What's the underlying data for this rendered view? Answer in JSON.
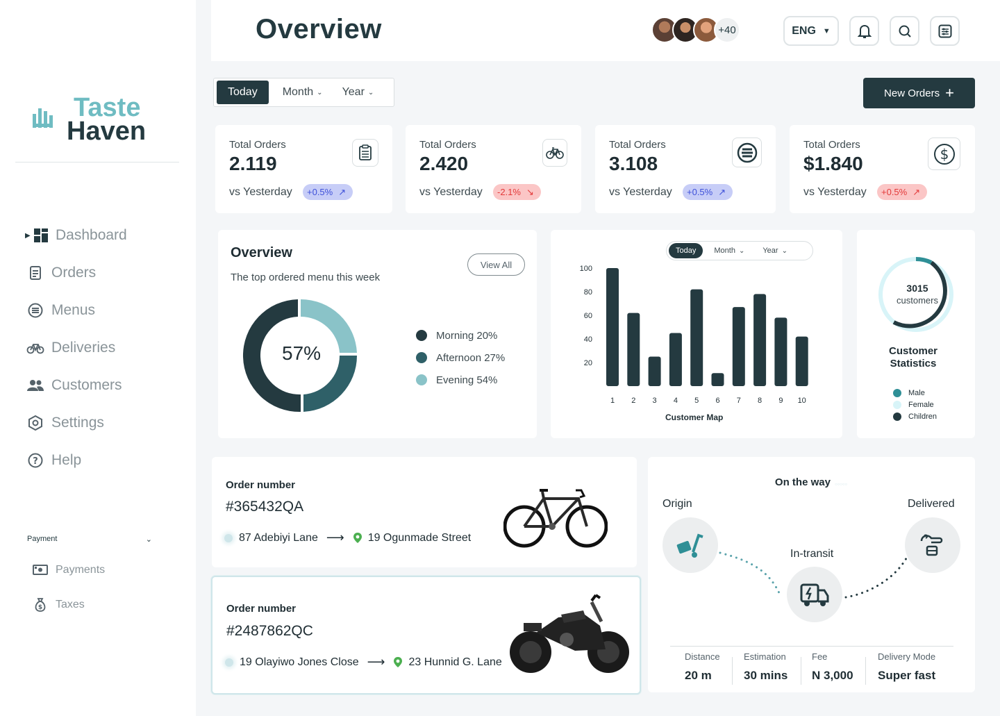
{
  "brand": {
    "line1": "Taste",
    "line2": "Haven"
  },
  "nav": [
    {
      "label": "Dashboard",
      "icon": "dashboard-icon"
    },
    {
      "label": "Orders",
      "icon": "orders-icon"
    },
    {
      "label": "Menus",
      "icon": "menus-icon"
    },
    {
      "label": "Deliveries",
      "icon": "bicycle-icon"
    },
    {
      "label": "Customers",
      "icon": "customers-icon"
    },
    {
      "label": "Settings",
      "icon": "settings-icon"
    },
    {
      "label": "Help",
      "icon": "help-icon"
    }
  ],
  "payment_section": {
    "heading": "Payment",
    "items": [
      {
        "label": "Payments",
        "icon": "cash-icon"
      },
      {
        "label": "Taxes",
        "icon": "money-bag-icon"
      }
    ]
  },
  "header": {
    "title": "Overview",
    "avatar_more": "+40",
    "language": "ENG"
  },
  "period": {
    "today": "Today",
    "month": "Month",
    "year": "Year"
  },
  "new_orders_label": "New Orders",
  "stats": [
    {
      "label": "Total Orders",
      "value": "2.119",
      "compare": "vs Yesterday",
      "change": "+0.5%",
      "trend": "up",
      "icon": "clipboard-icon"
    },
    {
      "label": "Total Orders",
      "value": "2.420",
      "compare": "vs Yesterday",
      "change": "-2.1%",
      "trend": "down",
      "icon": "bicycle-icon"
    },
    {
      "label": "Total Orders",
      "value": "3.108",
      "compare": "vs Yesterday",
      "change": "+0.5%",
      "trend": "up",
      "icon": "menu-lines-icon"
    },
    {
      "label": "Total Orders",
      "value": "$1.840",
      "compare": "vs Yesterday",
      "change": "+0.5%",
      "trend": "up-red",
      "icon": "dollar-icon"
    }
  ],
  "overview": {
    "title": "Overview",
    "subtitle": "The top ordered menu this week",
    "view_all": "View All",
    "center_label": "57%",
    "legend": [
      {
        "label": "Morning 20%",
        "color": "#243a40"
      },
      {
        "label": "Afternoon 27%",
        "color": "#2f6068"
      },
      {
        "label": "Evening 54%",
        "color": "#8ac3c8"
      }
    ]
  },
  "chart_data": {
    "type": "bar",
    "title": "Customer Map",
    "categories": [
      "1",
      "2",
      "3",
      "4",
      "5",
      "6",
      "7",
      "8",
      "9",
      "10"
    ],
    "values": [
      100,
      62,
      25,
      45,
      82,
      11,
      67,
      78,
      58,
      42
    ],
    "yticks": [
      100,
      80,
      60,
      40,
      20
    ],
    "ylim": [
      0,
      100
    ],
    "xlabel": "Customer Map",
    "ylabel": "",
    "period": {
      "today": "Today",
      "month": "Month",
      "year": "Year"
    },
    "color": "#243a40"
  },
  "customer_stats": {
    "count": "3015",
    "count_label": "customers",
    "title_line1": "Customer",
    "title_line2": "Statistics",
    "legend": [
      {
        "label": "Male",
        "color": "#2f8f96"
      },
      {
        "label": "Female",
        "color": "#d8f4f8"
      },
      {
        "label": "Children",
        "color": "#243a40"
      }
    ]
  },
  "orders": [
    {
      "number_label": "Order number",
      "number": "#365432QA",
      "from": "87 Adebiyi Lane",
      "to": "19 Ogunmade Street",
      "vehicle_icon": "bicycle-image"
    },
    {
      "number_label": "Order number",
      "number": "#2487862QC",
      "from": "19 Olayiwo Jones Close",
      "to": "23 Hunnid G. Lane",
      "vehicle_icon": "motorcycle-image"
    }
  ],
  "tracking": {
    "title": "On the way",
    "origin": "Origin",
    "transit": "In-transit",
    "delivered": "Delivered",
    "details": [
      {
        "key": "Distance",
        "value": "20 m"
      },
      {
        "key": "Estimation",
        "value": "30 mins"
      },
      {
        "key": "Fee",
        "value": "N 3,000"
      },
      {
        "key": "Delivery Mode",
        "value": "Super fast"
      }
    ]
  }
}
